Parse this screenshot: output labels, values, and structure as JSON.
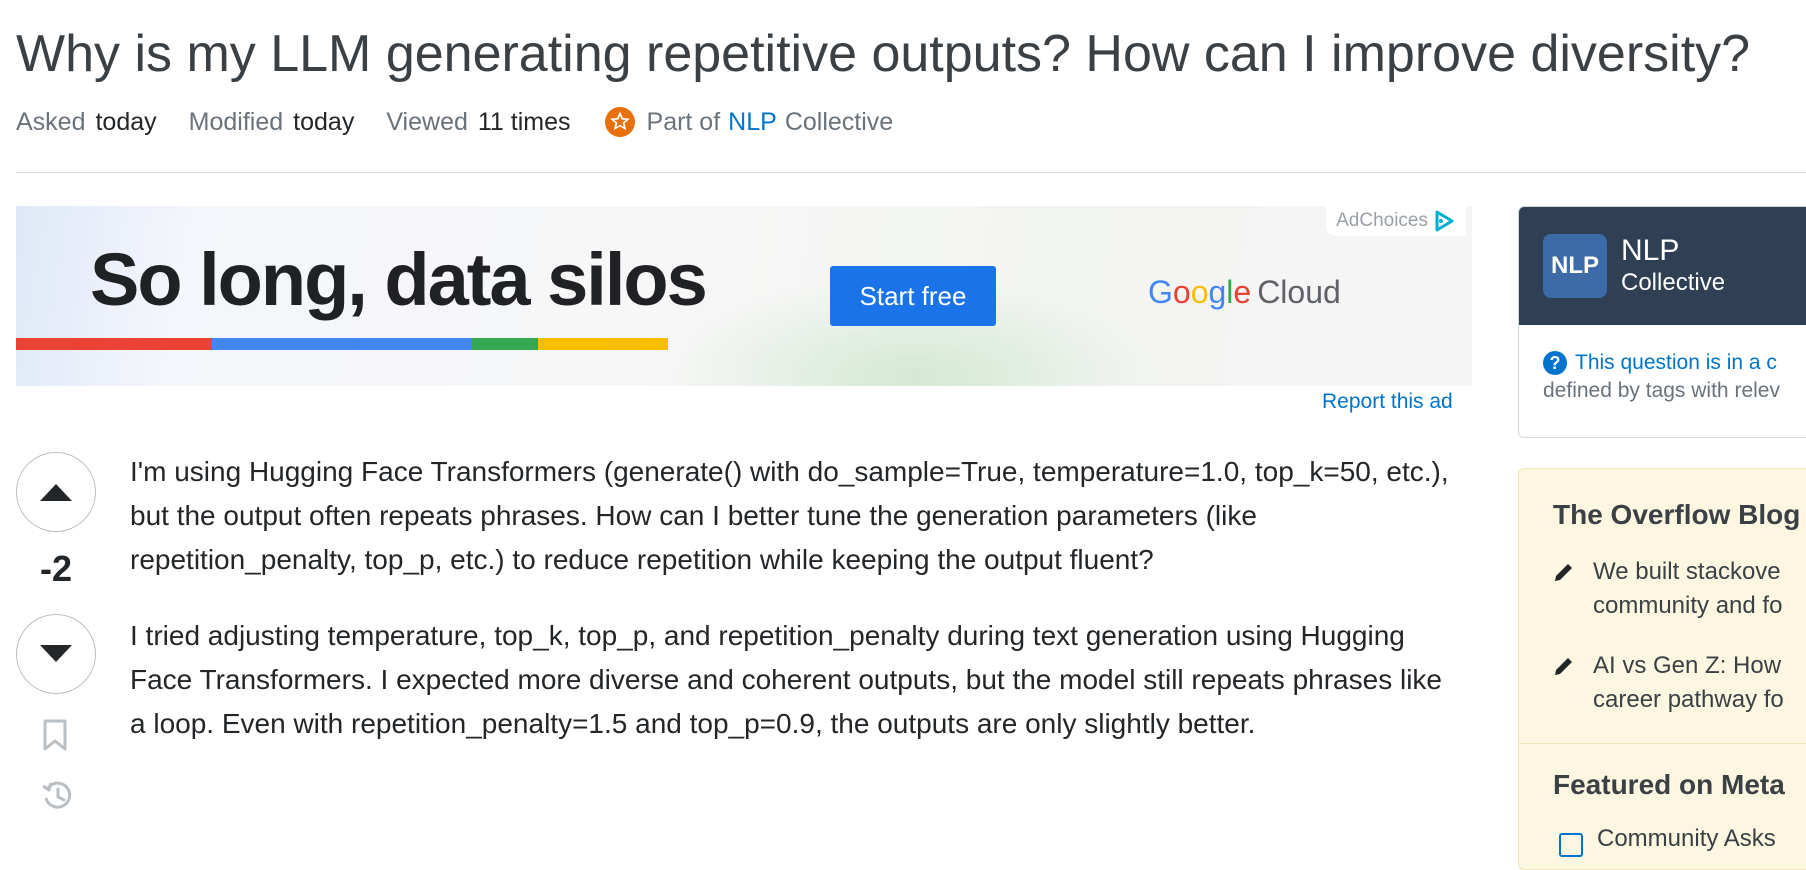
{
  "question": {
    "title": "Why is my LLM generating repetitive outputs? How can I improve diversity?",
    "asked_label": "Asked",
    "asked_value": "today",
    "modified_label": "Modified",
    "modified_value": "today",
    "viewed_label": "Viewed",
    "viewed_value": "11 times",
    "collective_prefix": "Part of",
    "collective_link": "NLP",
    "collective_suffix": "Collective",
    "score": "-2",
    "paragraphs": [
      "I'm using Hugging Face Transformers (generate() with do_sample=True, temperature=1.0, top_k=50, etc.), but the output often repeats phrases. How can I better tune the generation parameters (like repetition_penalty, top_p, etc.) to reduce repetition while keeping the output fluent?",
      "I tried adjusting temperature, top_k, top_p, and repetition_penalty during text generation using Hugging Face Transformers. I expected more diverse and coherent outputs, but the model still repeats phrases like a loop. Even with repetition_penalty=1.5 and top_p=0.9, the outputs are only slightly better."
    ]
  },
  "ad": {
    "headline": "So long, data silos",
    "cta": "Start free",
    "brand_google": "Google",
    "brand_cloud": "Cloud",
    "adchoices": "AdChoices",
    "report": "Report this ad",
    "stripe_colors": [
      "#ea4335",
      "#4285f4",
      "#34a853",
      "#fbbc04"
    ]
  },
  "sidebar": {
    "collective": {
      "logo_text": "NLP",
      "name_line1": "NLP",
      "name_line2": "Collective",
      "info_text": "This question is in a c",
      "desc_text": "defined by tags with relev"
    },
    "blog": {
      "heading": "The Overflow Blog",
      "items": [
        {
          "line1": "We built stackove",
          "line2": "community and fo"
        },
        {
          "line1": "AI vs Gen Z: How",
          "line2": "career pathway fo"
        }
      ],
      "featured_heading": "Featured on Meta",
      "featured_items": [
        "Community Asks"
      ]
    }
  },
  "colors": {
    "link": "#0074cc",
    "collective_header": "#2f3f54",
    "badge_orange": "#e7700d",
    "blog_bg": "#fdf7e2"
  }
}
